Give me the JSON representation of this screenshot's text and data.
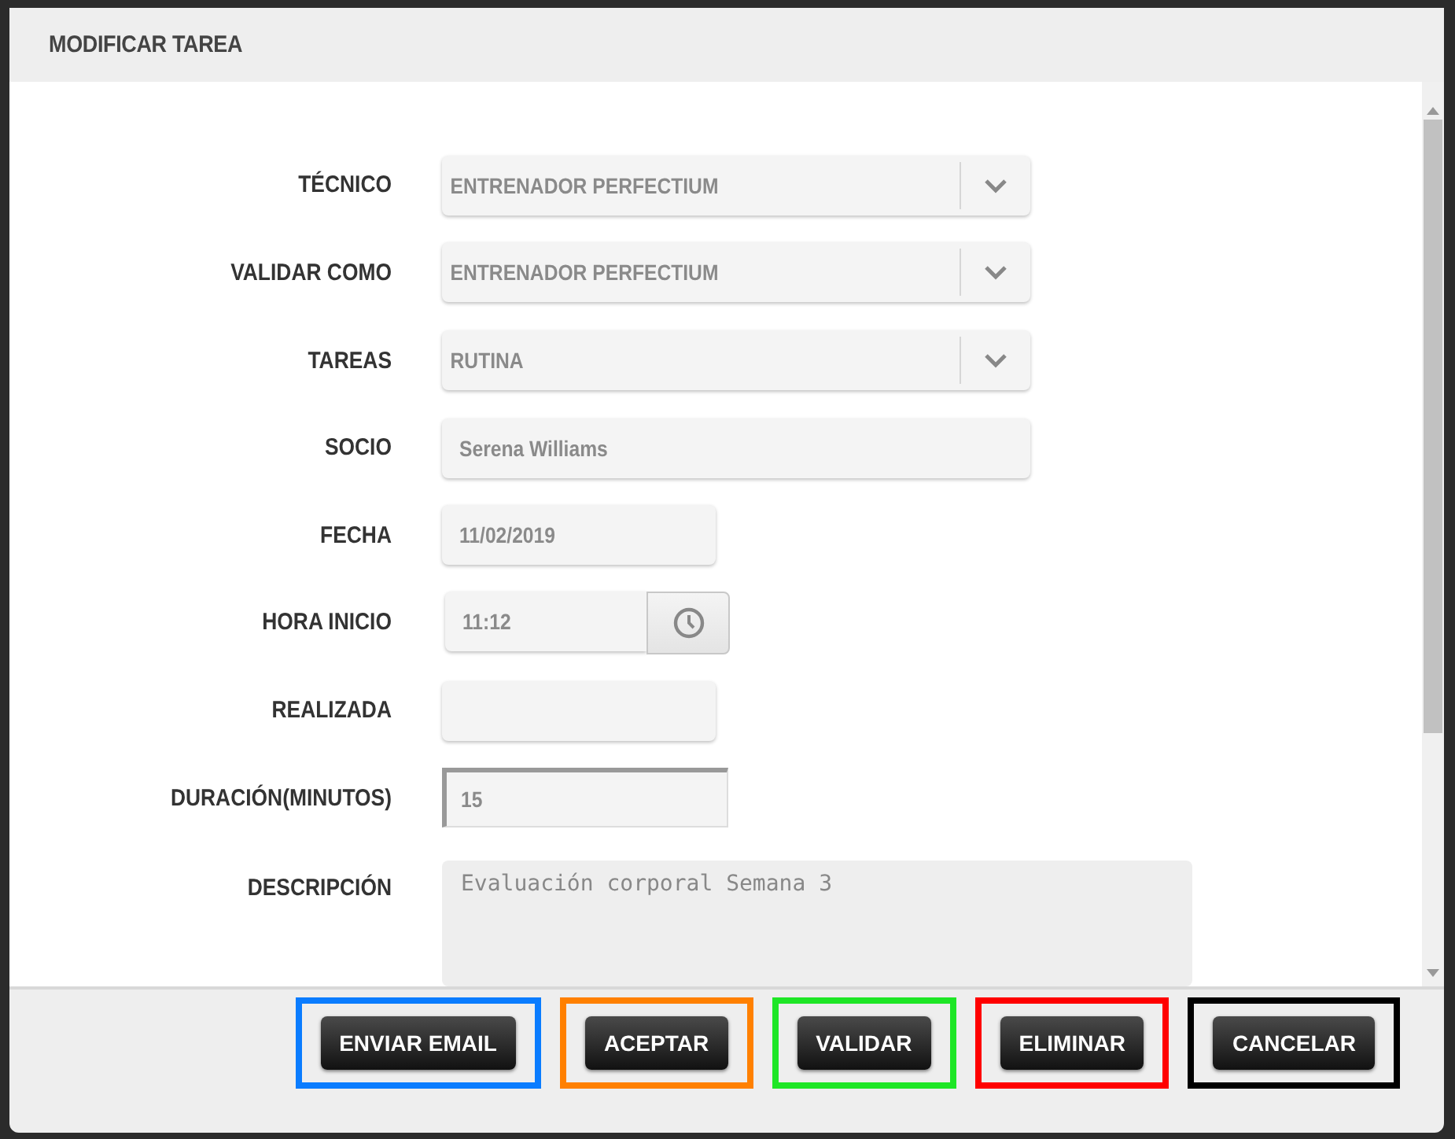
{
  "dialog": {
    "title": "MODIFICAR TAREA"
  },
  "fields": [
    {
      "label": "TÉCNICO",
      "kind": "select",
      "value": "ENTRENADOR PERFECTIUM"
    },
    {
      "label": "VALIDAR COMO",
      "kind": "select",
      "value": "ENTRENADOR PERFECTIUM"
    },
    {
      "label": "TAREAS",
      "kind": "select",
      "value": "RUTINA"
    },
    {
      "label": "SOCIO",
      "kind": "text",
      "value": "Serena Williams"
    },
    {
      "label": "FECHA",
      "kind": "date",
      "value": "11/02/2019"
    },
    {
      "label": "HORA INICIO",
      "kind": "time",
      "value": "11:12"
    },
    {
      "label": "REALIZADA",
      "kind": "date"
    },
    {
      "label": "DURACIÓN(MINUTOS)",
      "kind": "number",
      "value": "15"
    },
    {
      "label": "DESCRIPCIÓN",
      "kind": "textarea",
      "value": "Evaluación corporal Semana 3"
    }
  ],
  "buttons": [
    {
      "label": "ENVIAR EMAIL",
      "color": "#0a7cff"
    },
    {
      "label": "ACEPTAR",
      "color": "#ff8000"
    },
    {
      "label": "VALIDAR",
      "color": "#1ee626"
    },
    {
      "label": "ELIMINAR",
      "color": "#ff0000"
    },
    {
      "label": "CANCELAR",
      "color": "#000000"
    }
  ]
}
